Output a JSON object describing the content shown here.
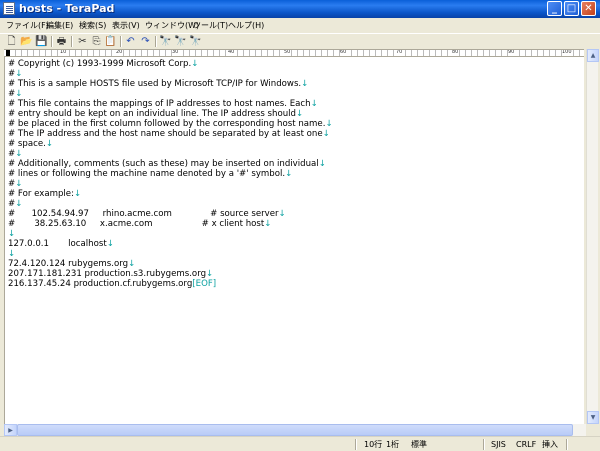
{
  "window": {
    "title": "hosts - TeraPad",
    "minimize_label": "_",
    "maximize_label": "□",
    "close_label": "✕"
  },
  "menu": [
    {
      "label": "ファイル(F)"
    },
    {
      "label": "編集(E)"
    },
    {
      "label": "検索(S)"
    },
    {
      "label": "表示(V)"
    },
    {
      "label": "ウィンドウ(W)"
    },
    {
      "label": "ツール(T)"
    },
    {
      "label": "ヘルプ(H)"
    }
  ],
  "toolbar": {
    "icons": [
      "new-file-icon",
      "open-folder-icon",
      "save-icon",
      "print-icon",
      "cut-icon",
      "copy-icon",
      "paste-icon",
      "undo-icon",
      "redo-icon",
      "find-icon",
      "find-next-icon",
      "find-prev-icon"
    ]
  },
  "ruler": {
    "marks": [
      "10",
      "20",
      "30",
      "40",
      "50",
      "60",
      "70",
      "80",
      "90",
      "100"
    ]
  },
  "editor": {
    "lines": [
      {
        "text": "# Copyright (c) 1993-1999 Microsoft Corp.",
        "eol": "↓"
      },
      {
        "text": "#",
        "eol": "↓"
      },
      {
        "text": "# This is a sample HOSTS file used by Microsoft TCP/IP for Windows.",
        "eol": "↓"
      },
      {
        "text": "#",
        "eol": "↓"
      },
      {
        "text": "# This file contains the mappings of IP addresses to host names. Each",
        "eol": "↓"
      },
      {
        "text": "# entry should be kept on an individual line. The IP address should",
        "eol": "↓"
      },
      {
        "text": "# be placed in the first column followed by the corresponding host name.",
        "eol": "↓"
      },
      {
        "text": "# The IP address and the host name should be separated by at least one",
        "eol": "↓"
      },
      {
        "text": "# space.",
        "eol": "↓"
      },
      {
        "text": "#",
        "eol": "↓"
      },
      {
        "text": "# Additionally, comments (such as these) may be inserted on individual",
        "eol": "↓"
      },
      {
        "text": "# lines or following the machine name denoted by a '#' symbol.",
        "eol": "↓"
      },
      {
        "text": "#",
        "eol": "↓"
      },
      {
        "text": "# For example:",
        "eol": "↓"
      },
      {
        "text": "#",
        "eol": "↓"
      },
      {
        "text": "#      102.54.94.97     rhino.acme.com              # source server",
        "eol": "↓"
      },
      {
        "text": "#       38.25.63.10     x.acme.com                  # x client host",
        "eol": "↓"
      },
      {
        "text": "",
        "eol": "↓"
      },
      {
        "text": "127.0.0.1       localhost",
        "eol": "↓"
      },
      {
        "text": "",
        "eol": "↓"
      },
      {
        "text": "72.4.120.124 rubygems.org",
        "eol": "↓"
      },
      {
        "text": "207.171.181.231 production.s3.rubygems.org",
        "eol": "↓"
      },
      {
        "text": "216.137.45.24 production.cf.rubygems.org",
        "eol": "[EOF]"
      }
    ]
  },
  "statusbar": {
    "line": "10行",
    "column": "1桁",
    "mode": "標準",
    "encoding": "SJIS",
    "newline": "CRLF",
    "insert": "挿入"
  },
  "colors": {
    "titlebar": "#0a5fd8",
    "eol_marker": "#0aa0a0",
    "editor_bg": "#ffffff",
    "chrome_bg": "#ece9d8"
  }
}
